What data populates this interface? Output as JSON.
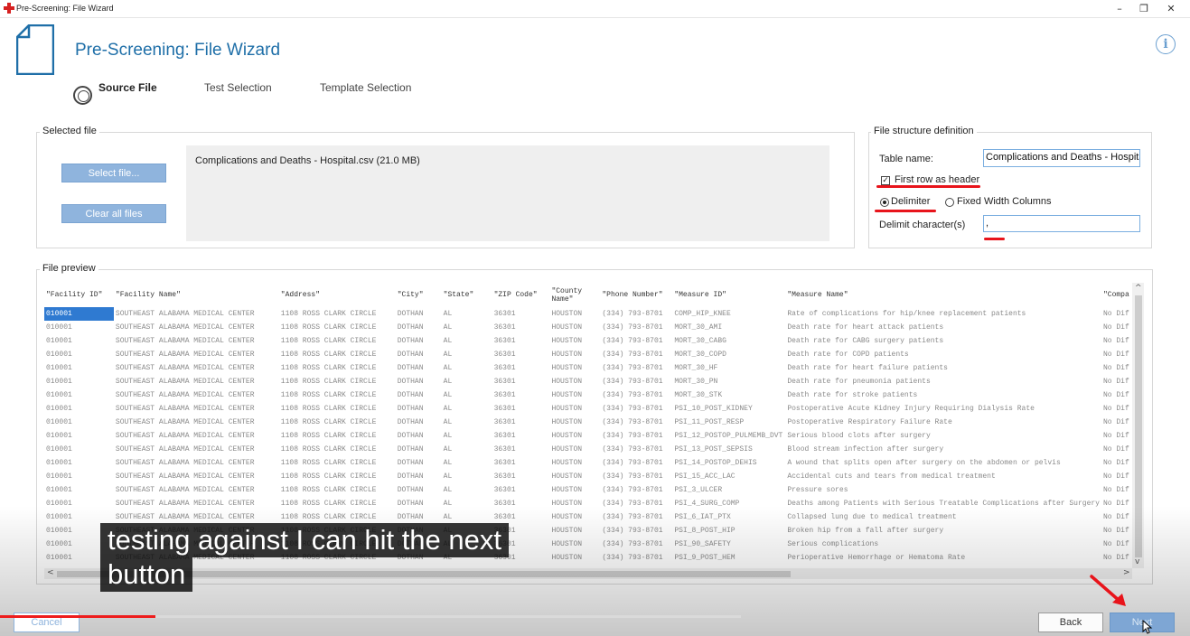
{
  "window": {
    "title": "Pre-Screening: File Wizard",
    "minimize": "–",
    "restore": "❐",
    "close": "✕"
  },
  "header": {
    "title": "Pre-Screening: File Wizard",
    "help": "i"
  },
  "steps": [
    {
      "label": "Source File"
    },
    {
      "label": "Test Selection"
    },
    {
      "label": "Template Selection"
    }
  ],
  "selected_file": {
    "legend": "Selected file",
    "select_button": "Select file...",
    "clear_button": "Clear all files",
    "file_info": "Complications and Deaths - Hospital.csv (21.0 MB)"
  },
  "file_structure": {
    "legend": "File structure definition",
    "table_name_label": "Table name:",
    "table_name_value": "Complications and Deaths - Hospital",
    "first_row_header_label": "First row as header",
    "first_row_header_checked": true,
    "delimiter_label": "Delimiter",
    "fixed_width_label": "Fixed Width Columns",
    "mode_selected": "Delimiter",
    "delimit_char_label": "Delimit character(s)",
    "delimit_char_value": ","
  },
  "preview": {
    "legend": "File preview",
    "columns": [
      "\"Facility ID\"",
      "\"Facility Name\"",
      "\"Address\"",
      "\"City\"",
      "\"State\"",
      "\"ZIP Code\"",
      "\"County Name\"",
      "\"Phone Number\"",
      "\"Measure ID\"",
      "\"Measure Name\"",
      "\"Compa"
    ],
    "rows": [
      [
        "010001",
        "SOUTHEAST ALABAMA MEDICAL CENTER",
        "1108 ROSS CLARK CIRCLE",
        "DOTHAN",
        "AL",
        "36301",
        "HOUSTON",
        "(334) 793-8701",
        "COMP_HIP_KNEE",
        "Rate of complications for hip/knee replacement patients",
        "No Dif"
      ],
      [
        "010001",
        "SOUTHEAST ALABAMA MEDICAL CENTER",
        "1108 ROSS CLARK CIRCLE",
        "DOTHAN",
        "AL",
        "36301",
        "HOUSTON",
        "(334) 793-8701",
        "MORT_30_AMI",
        "Death rate for heart attack patients",
        "No Dif"
      ],
      [
        "010001",
        "SOUTHEAST ALABAMA MEDICAL CENTER",
        "1108 ROSS CLARK CIRCLE",
        "DOTHAN",
        "AL",
        "36301",
        "HOUSTON",
        "(334) 793-8701",
        "MORT_30_CABG",
        "Death rate for CABG surgery patients",
        "No Dif"
      ],
      [
        "010001",
        "SOUTHEAST ALABAMA MEDICAL CENTER",
        "1108 ROSS CLARK CIRCLE",
        "DOTHAN",
        "AL",
        "36301",
        "HOUSTON",
        "(334) 793-8701",
        "MORT_30_COPD",
        "Death rate for COPD patients",
        "No Dif"
      ],
      [
        "010001",
        "SOUTHEAST ALABAMA MEDICAL CENTER",
        "1108 ROSS CLARK CIRCLE",
        "DOTHAN",
        "AL",
        "36301",
        "HOUSTON",
        "(334) 793-8701",
        "MORT_30_HF",
        "Death rate for heart failure patients",
        "No Dif"
      ],
      [
        "010001",
        "SOUTHEAST ALABAMA MEDICAL CENTER",
        "1108 ROSS CLARK CIRCLE",
        "DOTHAN",
        "AL",
        "36301",
        "HOUSTON",
        "(334) 793-8701",
        "MORT_30_PN",
        "Death rate for pneumonia patients",
        "No Dif"
      ],
      [
        "010001",
        "SOUTHEAST ALABAMA MEDICAL CENTER",
        "1108 ROSS CLARK CIRCLE",
        "DOTHAN",
        "AL",
        "36301",
        "HOUSTON",
        "(334) 793-8701",
        "MORT_30_STK",
        "Death rate for stroke patients",
        "No Dif"
      ],
      [
        "010001",
        "SOUTHEAST ALABAMA MEDICAL CENTER",
        "1108 ROSS CLARK CIRCLE",
        "DOTHAN",
        "AL",
        "36301",
        "HOUSTON",
        "(334) 793-8701",
        "PSI_10_POST_KIDNEY",
        "Postoperative Acute Kidney Injury Requiring Dialysis Rate",
        "No Dif"
      ],
      [
        "010001",
        "SOUTHEAST ALABAMA MEDICAL CENTER",
        "1108 ROSS CLARK CIRCLE",
        "DOTHAN",
        "AL",
        "36301",
        "HOUSTON",
        "(334) 793-8701",
        "PSI_11_POST_RESP",
        "Postoperative Respiratory Failure Rate",
        "No Dif"
      ],
      [
        "010001",
        "SOUTHEAST ALABAMA MEDICAL CENTER",
        "1108 ROSS CLARK CIRCLE",
        "DOTHAN",
        "AL",
        "36301",
        "HOUSTON",
        "(334) 793-8701",
        "PSI_12_POSTOP_PULMEMB_DVT",
        "Serious blood clots after surgery",
        "No Dif"
      ],
      [
        "010001",
        "SOUTHEAST ALABAMA MEDICAL CENTER",
        "1108 ROSS CLARK CIRCLE",
        "DOTHAN",
        "AL",
        "36301",
        "HOUSTON",
        "(334) 793-8701",
        "PSI_13_POST_SEPSIS",
        "Blood stream infection after surgery",
        "No Dif"
      ],
      [
        "010001",
        "SOUTHEAST ALABAMA MEDICAL CENTER",
        "1108 ROSS CLARK CIRCLE",
        "DOTHAN",
        "AL",
        "36301",
        "HOUSTON",
        "(334) 793-8701",
        "PSI_14_POSTOP_DEHIS",
        "A wound that splits open after surgery on the abdomen or pelvis",
        "No Dif"
      ],
      [
        "010001",
        "SOUTHEAST ALABAMA MEDICAL CENTER",
        "1108 ROSS CLARK CIRCLE",
        "DOTHAN",
        "AL",
        "36301",
        "HOUSTON",
        "(334) 793-8701",
        "PSI_15_ACC_LAC",
        "Accidental cuts and tears from medical treatment",
        "No Dif"
      ],
      [
        "010001",
        "SOUTHEAST ALABAMA MEDICAL CENTER",
        "1108 ROSS CLARK CIRCLE",
        "DOTHAN",
        "AL",
        "36301",
        "HOUSTON",
        "(334) 793-8701",
        "PSI_3_ULCER",
        "Pressure sores",
        "No Dif"
      ],
      [
        "010001",
        "SOUTHEAST ALABAMA MEDICAL CENTER",
        "1108 ROSS CLARK CIRCLE",
        "DOTHAN",
        "AL",
        "36301",
        "HOUSTON",
        "(334) 793-8701",
        "PSI_4_SURG_COMP",
        "Deaths among Patients with Serious Treatable Complications after Surgery",
        "No Dif"
      ],
      [
        "010001",
        "SOUTHEAST ALABAMA MEDICAL CENTER",
        "1108 ROSS CLARK CIRCLE",
        "DOTHAN",
        "AL",
        "36301",
        "HOUSTON",
        "(334) 793-8701",
        "PSI_6_IAT_PTX",
        "Collapsed lung due to medical treatment",
        "No Dif"
      ],
      [
        "010001",
        "SOUTHEAST ALABAMA MEDICAL CENTER",
        "1108 ROSS CLARK CIRCLE",
        "DOTHAN",
        "AL",
        "36301",
        "HOUSTON",
        "(334) 793-8701",
        "PSI_8_POST_HIP",
        "Broken hip from a fall after surgery",
        "No Dif"
      ],
      [
        "010001",
        "SOUTHEAST ALABAMA MEDICAL CENTER",
        "1108 ROSS CLARK CIRCLE",
        "DOTHAN",
        "AL",
        "36301",
        "HOUSTON",
        "(334) 793-8701",
        "PSI_90_SAFETY",
        "Serious complications",
        "No Dif"
      ],
      [
        "010001",
        "SOUTHEAST ALABAMA MEDICAL CENTER",
        "1108 ROSS CLARK CIRCLE",
        "DOTHAN",
        "AL",
        "36301",
        "HOUSTON",
        "(334) 793-8701",
        "PSI_9_POST_HEM",
        "Perioperative Hemorrhage or Hematoma Rate",
        "No Dif"
      ]
    ],
    "scroll_up": "^",
    "scroll_down": "v",
    "scroll_left": "<",
    "scroll_right": ">"
  },
  "caption": {
    "line1": "testing against I can hit the next",
    "line2": "button"
  },
  "footer": {
    "cancel": "Cancel",
    "back": "Back",
    "next": "Next"
  },
  "video": {
    "progress": 0.21
  },
  "colors": {
    "accent": "#1f6fa8",
    "button_blue": "#8fb4dd",
    "selection": "#2f7ad1",
    "annotation_red": "#e8141b"
  }
}
